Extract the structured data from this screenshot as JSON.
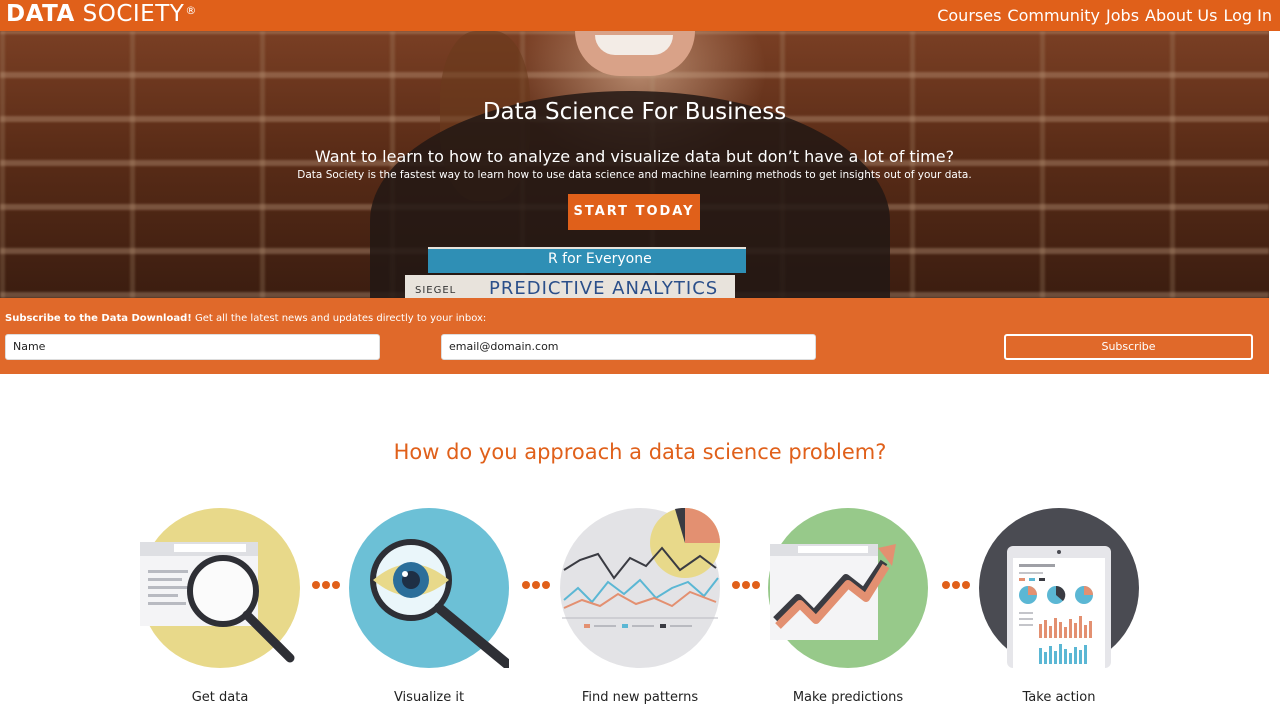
{
  "header": {
    "logo_bold": "DATA",
    "logo_light": "SOCIETY",
    "logo_mark": "®",
    "nav": [
      "Courses",
      "Community",
      "Jobs",
      "About Us",
      "Log In"
    ]
  },
  "hero": {
    "title": "Data Science For Business",
    "subtitle": "Want to learn to how to analyze and visualize data but don’t have a lot of time?",
    "description": "Data Society is the fastest way to learn how to use data science and machine learning methods to get insights out of your data.",
    "cta": "START TODAY",
    "book_top": "R for Everyone",
    "book_bottom_author": "SIEGEL",
    "book_bottom_title": "PREDICTIVE ANALYTICS"
  },
  "subscribe": {
    "lead": "Subscribe to the Data Download!",
    "text": " Get all the latest news and updates directly to your inbox:",
    "name_value": "Name",
    "email_value": "email@domain.com",
    "button": "Subscribe"
  },
  "approach": {
    "title": "How do you approach a data science problem?",
    "steps": [
      "Get data",
      "Visualize it",
      "Find new patterns",
      "Make predictions",
      "Take action"
    ]
  },
  "colors": {
    "brand_orange": "#e0601a",
    "circle_yellow": "#e8d98a",
    "circle_blue": "#6cc0d6",
    "circle_grey": "#e3e3e6",
    "circle_green": "#97c98a",
    "circle_dark": "#4a4b52"
  }
}
